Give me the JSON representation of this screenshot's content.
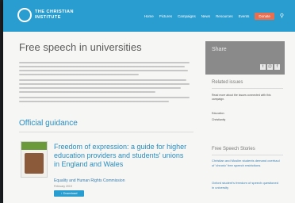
{
  "header": {
    "logo_line1": "THE CHRISTIAN",
    "logo_line2": "INSTITUTE",
    "nav": [
      "Home",
      "Pictures",
      "Campaigns",
      "News",
      "Resources",
      "Events"
    ],
    "donate_label": "Donate",
    "search_icon": "search-icon"
  },
  "main": {
    "title": "Free speech in universities",
    "guidance_heading": "Official guidance",
    "document": {
      "title": "Freedom of expression: a guide for higher education providers and students' unions in England and Wales",
      "publisher": "Equality and Human Rights Commission",
      "date": "February 2019",
      "download_label": "Download"
    }
  },
  "sidebar": {
    "share_label": "Share",
    "share_icons": [
      "twitter-icon",
      "email-icon",
      "facebook-icon"
    ],
    "related_heading": "Related issues",
    "related_text": "Read more about the issues connected with this campaign.",
    "related_items": [
      "Education",
      "Christianity"
    ],
    "stories_heading": "Free Speech Stories",
    "stories": [
      {
        "title": "Christian and Muslim students demand overhaul of 'chronic' free speech restrictions"
      },
      {
        "title": "Oxford student's freedom of speech questioned in university"
      }
    ]
  }
}
